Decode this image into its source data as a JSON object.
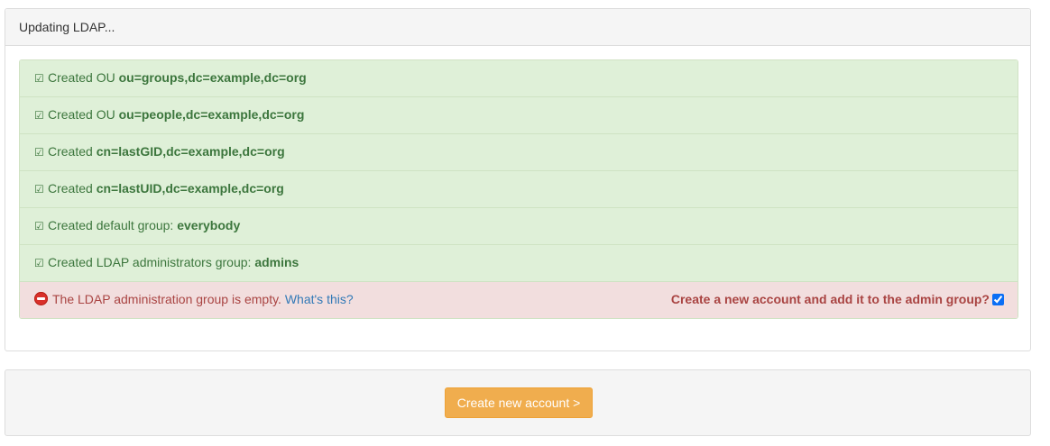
{
  "panel": {
    "title": "Updating LDAP..."
  },
  "results": [
    {
      "prefix": "Created OU ",
      "value": "ou=groups,dc=example,dc=org"
    },
    {
      "prefix": "Created OU ",
      "value": "ou=people,dc=example,dc=org"
    },
    {
      "prefix": "Created ",
      "value": "cn=lastGID,dc=example,dc=org"
    },
    {
      "prefix": "Created ",
      "value": "cn=lastUID,dc=example,dc=org"
    },
    {
      "prefix": "Created default group: ",
      "value": "everybody"
    },
    {
      "prefix": "Created LDAP administrators group: ",
      "value": "admins"
    }
  ],
  "check_glyph": "☑",
  "error": {
    "message": "The LDAP administration group is empty. ",
    "link": "What's this?",
    "question": "Create a new account and add it to the admin group?",
    "checkbox_checked": true
  },
  "footer": {
    "button_label": "Create new account >"
  },
  "colors": {
    "success_bg": "#dff0d8",
    "success_text": "#3c763d",
    "danger_bg": "#f2dede",
    "danger_text": "#a94442",
    "link": "#337ab7",
    "warning_button": "#f0ad4e"
  }
}
